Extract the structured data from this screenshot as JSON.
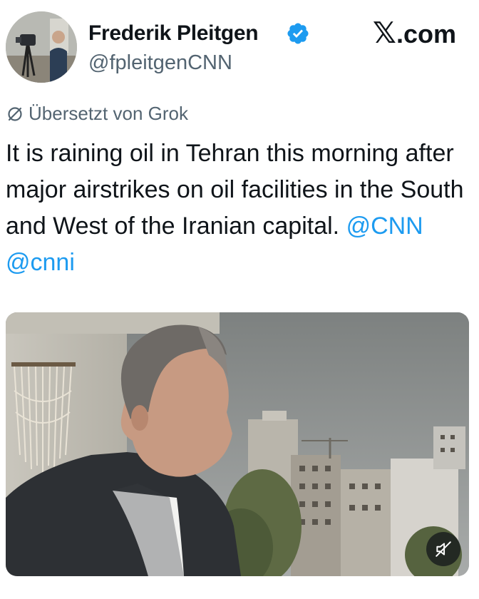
{
  "author": {
    "name": "Frederik Pleitgen",
    "handle": "@fpleitgenCNN",
    "verified": true,
    "avatar_icon": "profile-photo"
  },
  "site": {
    "logo": "𝕏",
    "suffix": ".com"
  },
  "translation": {
    "label": "Übersetzt von Grok",
    "icon": "grok-icon"
  },
  "tweet": {
    "text": "It is raining oil in Tehran this morning after major airstrikes on oil facilities in the South and West of the Iranian capital.",
    "mentions": [
      "@CNN",
      "@cnni"
    ]
  },
  "media": {
    "type": "video",
    "mute_icon": "muted-speaker-icon",
    "muted": true
  },
  "colors": {
    "accent": "#1d9bf0",
    "text": "#0f1419",
    "secondary": "#536471"
  }
}
